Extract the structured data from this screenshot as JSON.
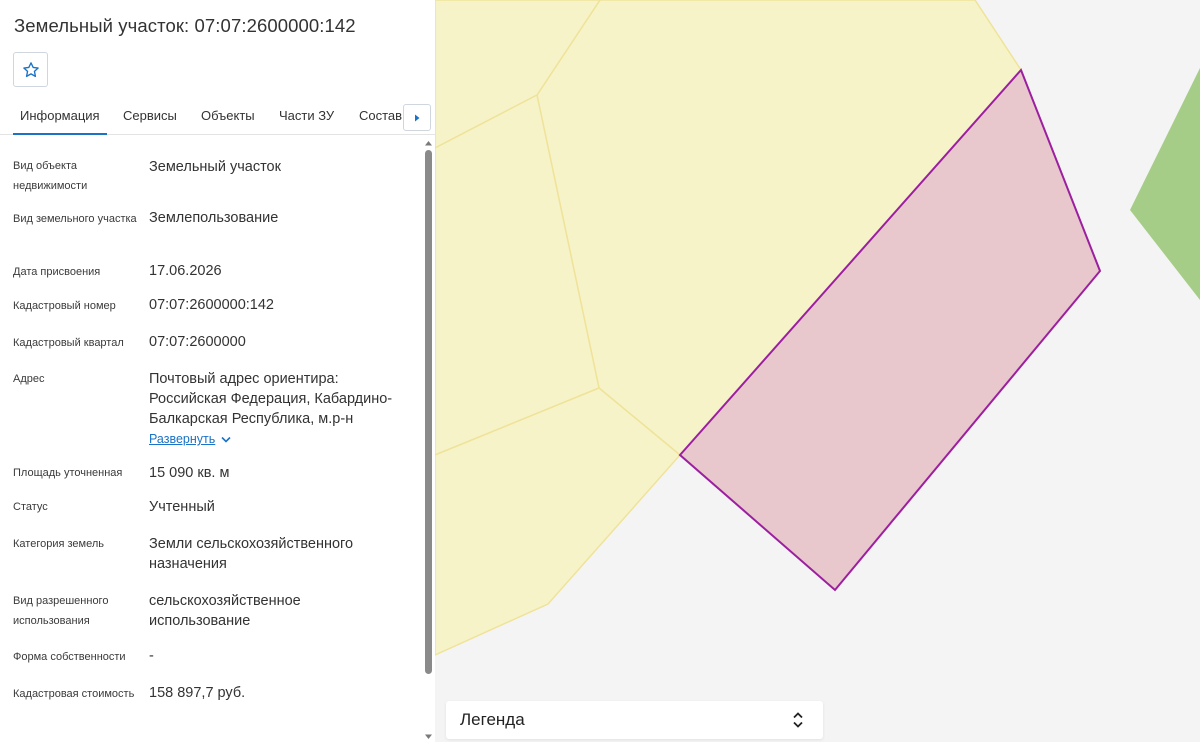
{
  "header": {
    "title": "Земельный участок: 07:07:2600000:142"
  },
  "tabs": [
    {
      "label": "Информация",
      "active": true
    },
    {
      "label": "Сервисы",
      "active": false
    },
    {
      "label": "Объекты",
      "active": false
    },
    {
      "label": "Части ЗУ",
      "active": false
    },
    {
      "label": "Состав",
      "active": false
    }
  ],
  "fields": {
    "object_type": {
      "label": "Вид объекта недвижимости",
      "value": "Земельный участок"
    },
    "land_type": {
      "label": "Вид земельного участка",
      "value": "Землепользование"
    },
    "assign_date": {
      "label": "Дата присвоения",
      "value": "17.06.2026"
    },
    "cadastral_number": {
      "label": "Кадастровый номер",
      "value": "07:07:2600000:142"
    },
    "cadastral_quarter": {
      "label": "Кадастровый квартал",
      "value": "07:07:2600000"
    },
    "address": {
      "label": "Адрес",
      "value": "Почтовый адрес ориентира: Российская Федерация, Кабардино-Балкарская Республика, м.р-н",
      "expand_label": "Развернуть"
    },
    "area": {
      "label": "Площадь уточненная",
      "value": "15 090 кв. м"
    },
    "status": {
      "label": "Статус",
      "value": "Учтенный"
    },
    "land_category": {
      "label": "Категория земель",
      "value": "Земли сельскохозяйственного назначения"
    },
    "permitted_use": {
      "label": "Вид разрешенного использования",
      "value": "сельскохозяйственное использование"
    },
    "ownership": {
      "label": "Форма собственности",
      "value": "-"
    },
    "cadastral_value": {
      "label": "Кадастровая стоимость",
      "value": "158 897,7 руб."
    }
  },
  "legend": {
    "title": "Легенда"
  },
  "colors": {
    "accent": "#1a73c6",
    "parcel_fill": "#e8c8cc",
    "parcel_stroke": "#9b1fa0",
    "neighbor_fill": "#f7f3c9",
    "neighbor_stroke": "#efe39a",
    "green_area": "#a5cd88",
    "map_background": "#f4f4f4"
  }
}
